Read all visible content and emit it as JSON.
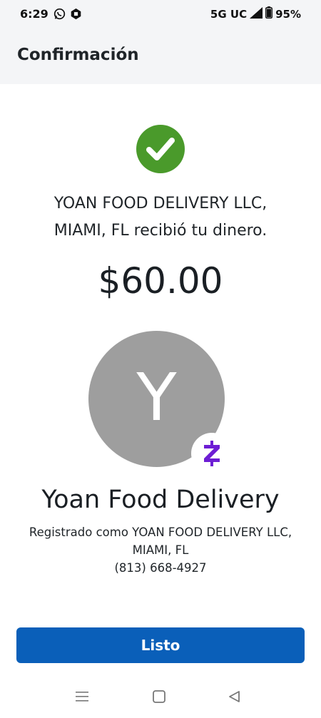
{
  "status_bar": {
    "time": "6:29",
    "network": "5G UC",
    "battery": "95%"
  },
  "header": {
    "title": "Confirmación"
  },
  "confirmation": {
    "message_line1": "YOAN FOOD DELIVERY LLC,",
    "message_line2": "MIAMI, FL recibió tu dinero.",
    "amount": "$60.00"
  },
  "recipient": {
    "avatar_initial": "Y",
    "name": "Yoan Food Delivery",
    "registered_line1": "Registrado como YOAN FOOD DELIVERY LLC,",
    "registered_line2": "MIAMI, FL",
    "phone": "(813) 668-4927"
  },
  "actions": {
    "done_label": "Listo"
  },
  "colors": {
    "success_green": "#4a9a2b",
    "primary_blue": "#0a5fb9",
    "zelle_purple": "#6d1ed4",
    "avatar_gray": "#9e9e9e"
  }
}
